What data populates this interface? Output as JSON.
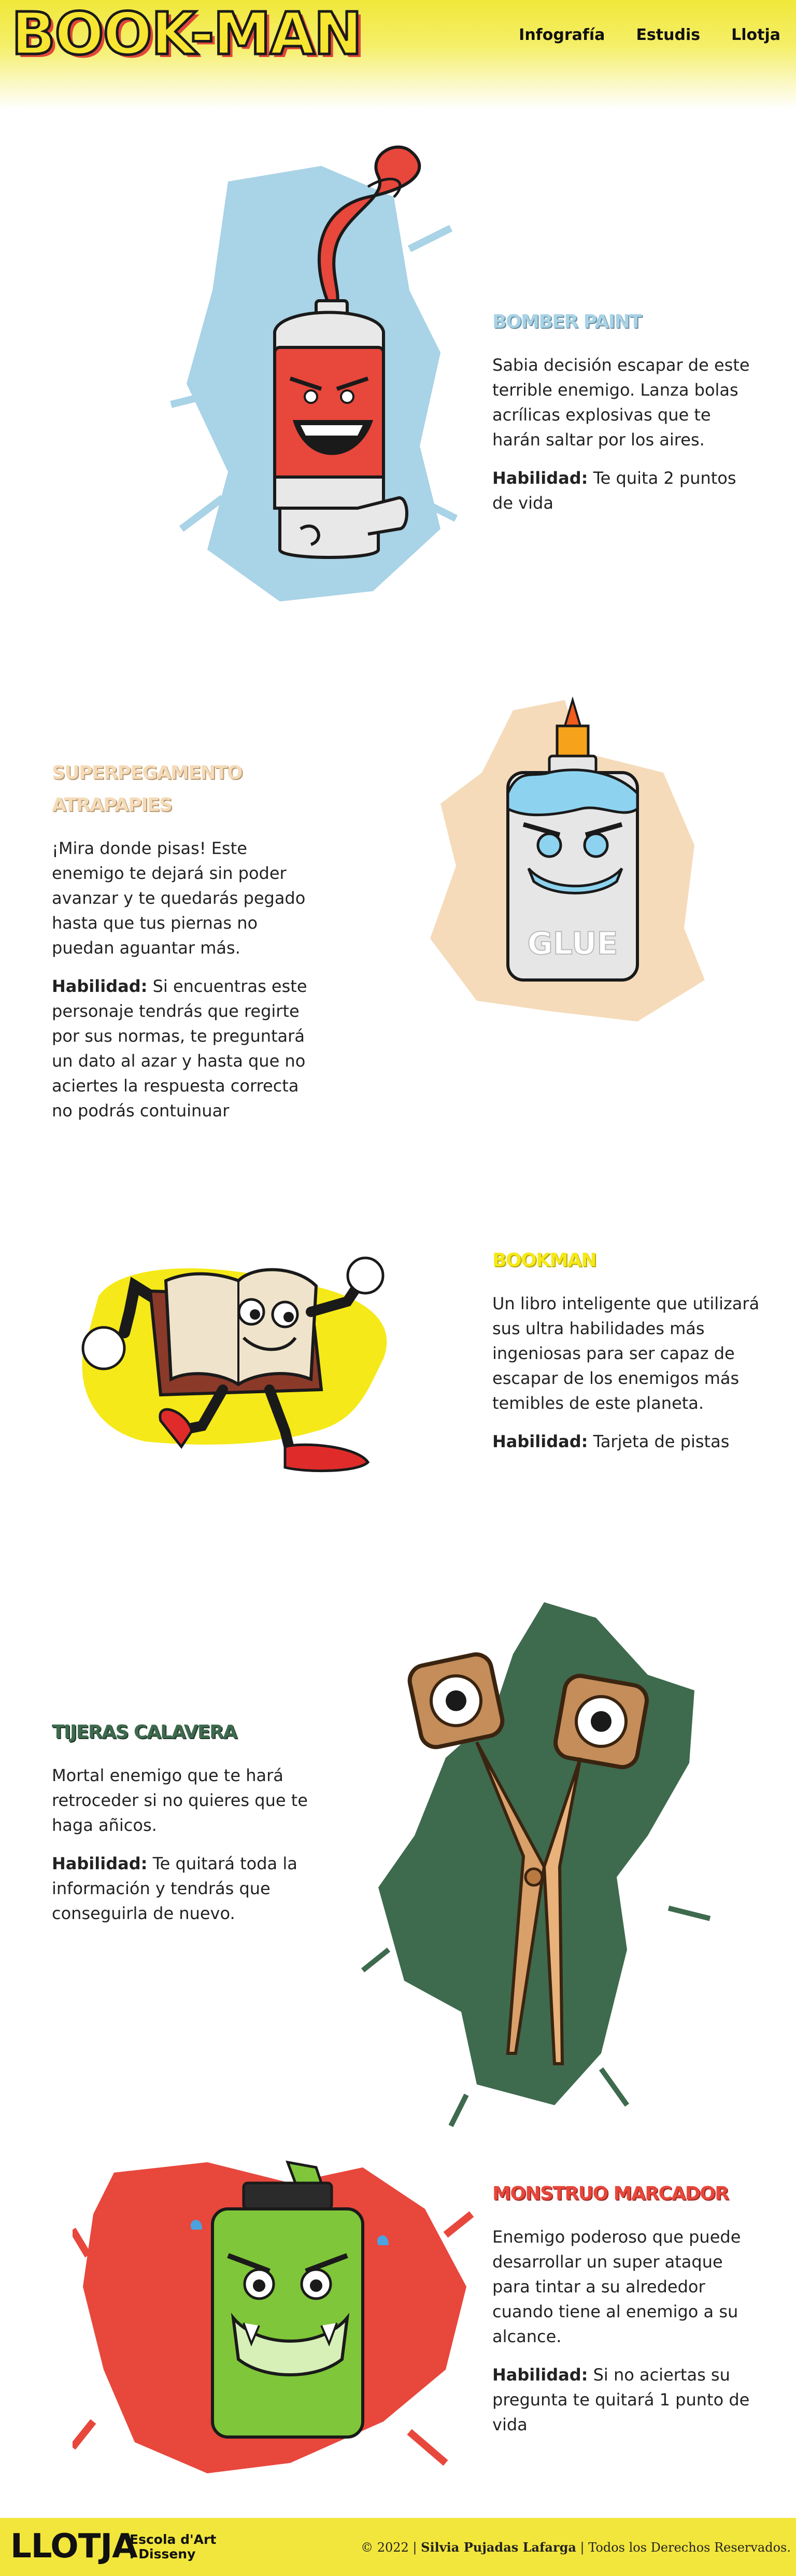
{
  "header": {
    "logo": "BOOK-MAN",
    "nav": [
      "Infografía",
      "Estudis",
      "Llotja"
    ]
  },
  "characters": [
    {
      "title": "BOMBER PAINT",
      "description": "Sabia decisión escapar de este terrible enemigo. Lanza bolas acrílicas explosivas que te harán saltar por los aires.",
      "ability_label": "Habilidad:",
      "ability": "Te quita 2 puntos de vida",
      "color": "#a9d3e6"
    },
    {
      "title": "SUPERPEGAMENTO ATRAPAPIES",
      "description": "¡Mira donde pisas! Este enemigo te dejará sin poder avanzar y te quedarás pegado hasta que tus piernas no puedan aguantar más.",
      "ability_label": "Habilidad:",
      "ability": "Si encuentras este personaje tendrás que regirte por sus normas, te preguntará un dato al azar y hasta que no aciertes la respuesta correcta no podrás contuinuar",
      "color": "#f5dbb9",
      "glue_label": "GLUE"
    },
    {
      "title": "BOOKMAN",
      "description": "Un libro inteligente que utilizará sus ultra habilidades más ingeniosas para ser capaz de escapar de los enemigos más temibles de este planeta.",
      "ability_label": "Habilidad:",
      "ability": "Tarjeta de pistas",
      "color": "#f5e919"
    },
    {
      "title": "TIJERAS CALAVERA",
      "description": "Mortal enemigo que te hará retroceder si no quieres que te haga añicos.",
      "ability_label": "Habilidad:",
      "ability": "Te quitará toda la información y tendrás que conseguirla de nuevo.",
      "color": "#3e6a4e"
    },
    {
      "title": "MONSTRUO MARCADOR",
      "description": "Enemigo poderoso que puede desarrollar un super ataque para tintar a su alrededor cuando tiene al enemigo a su alcance.",
      "ability_label": "Habilidad:",
      "ability": "Si no aciertas su pregunta te quitará 1 punto de vida",
      "color": "#e8473c"
    }
  ],
  "footer": {
    "logo": "LLOTJA",
    "school_line1": "Escola d'Art",
    "school_line2": "i Disseny",
    "copyright_prefix": "© 2022 |",
    "author": "Silvia Pujadas Lafarga",
    "copyright_suffix": "| Todos los Derechos Reservados."
  }
}
